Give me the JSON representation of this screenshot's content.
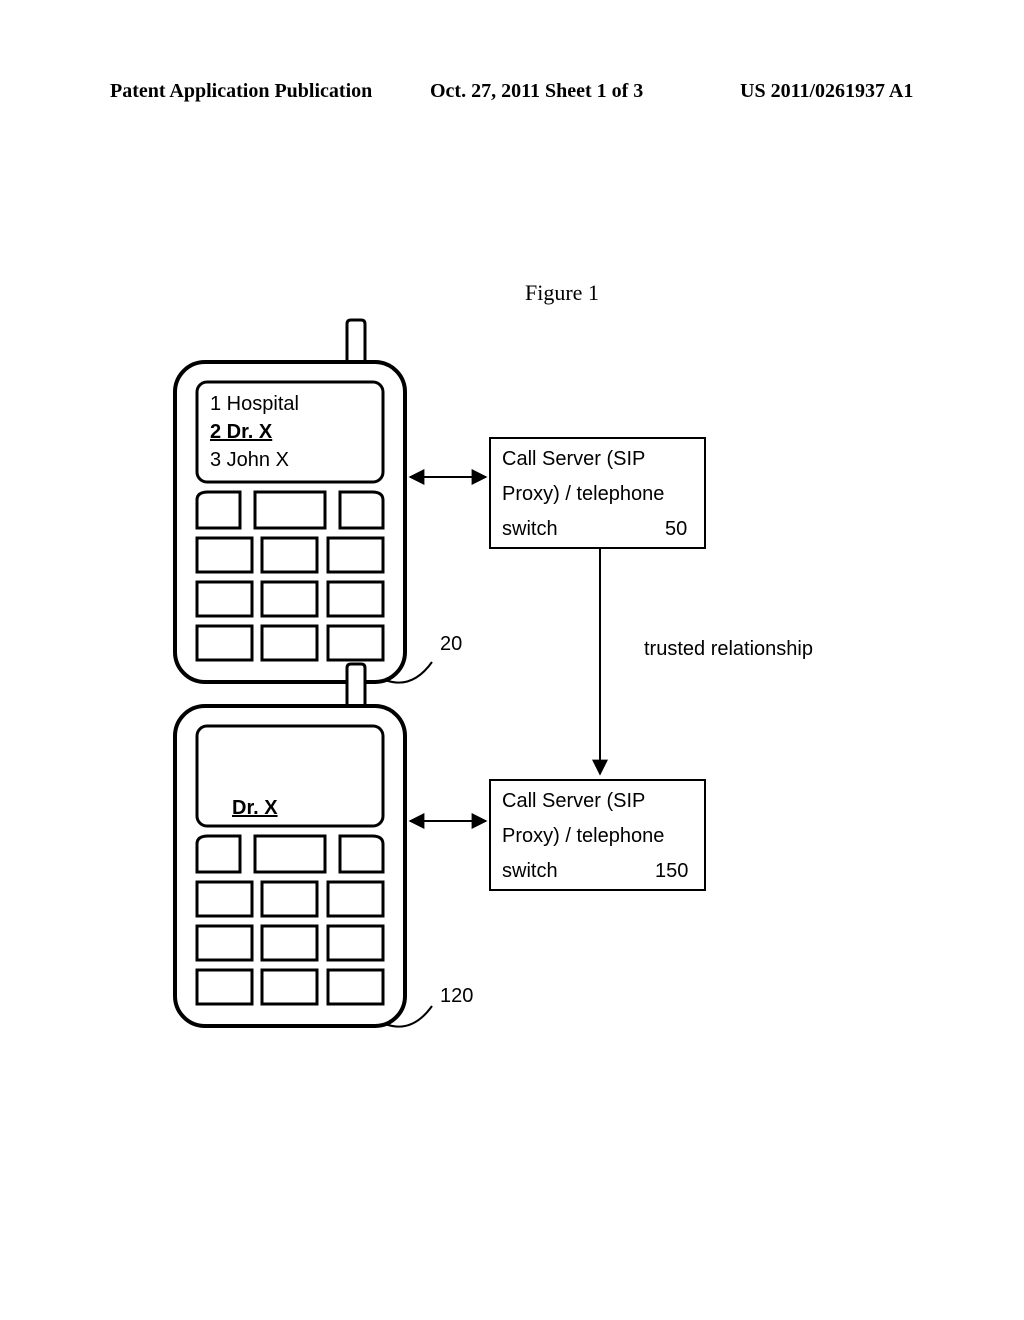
{
  "header": {
    "left": "Patent Application Publication",
    "center": "Oct. 27, 2011  Sheet 1 of 3",
    "right": "US 2011/0261937 A1"
  },
  "figure_label": "Figure 1",
  "phone_top": {
    "lines": [
      "1 Hospital",
      "2 Dr. X",
      "3 John X"
    ],
    "ref_label": "20"
  },
  "phone_bottom": {
    "display": " Dr. X",
    "ref_label": "120"
  },
  "server_top": {
    "line1": "Call Server (SIP",
    "line2": "Proxy)  /  telephone",
    "line3": "switch",
    "ref": "50"
  },
  "server_bottom": {
    "line1": "Call Server (SIP",
    "line2": "Proxy)  /  telephone",
    "line3": "switch",
    "ref": "150"
  },
  "relationship_label": "trusted relationship"
}
